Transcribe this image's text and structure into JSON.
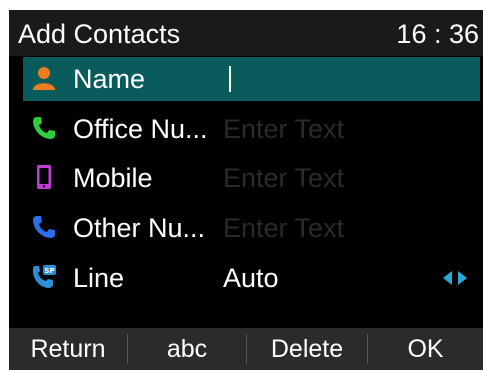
{
  "header": {
    "title": "Add Contacts",
    "clock": "16 : 36"
  },
  "fields": [
    {
      "icon": "person-icon",
      "label": "Name",
      "value": "",
      "placeholder": ""
    },
    {
      "icon": "office-phone-icon",
      "label": "Office Nu...",
      "value": "",
      "placeholder": "Enter Text"
    },
    {
      "icon": "mobile-phone-icon",
      "label": "Mobile",
      "value": "",
      "placeholder": "Enter Text"
    },
    {
      "icon": "other-phone-icon",
      "label": "Other Nu...",
      "value": "",
      "placeholder": "Enter Text"
    },
    {
      "icon": "sip-line-icon",
      "label": "Line",
      "value": "Auto",
      "placeholder": ""
    }
  ],
  "softkeys": {
    "return": "Return",
    "abc": "abc",
    "delete": "Delete",
    "ok": "OK"
  },
  "colors": {
    "selection": "#0a5c5c",
    "person_icon": "#f07c1f",
    "office_icon": "#2ecc40",
    "mobile_icon": "#c33cd6",
    "other_icon": "#2a6fe8",
    "line_icon": "#2a8fd6",
    "arrows": "#2aa8d6"
  }
}
